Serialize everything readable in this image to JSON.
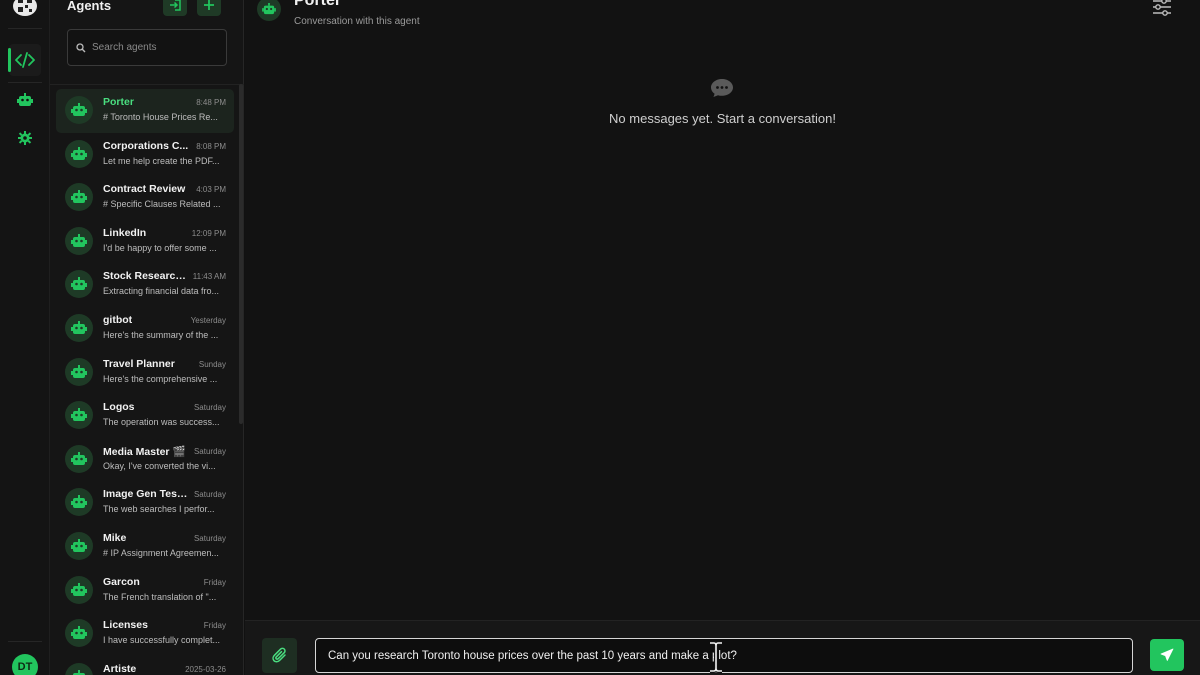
{
  "rail": {
    "user_initials": "DT"
  },
  "agents_panel": {
    "title": "Agents",
    "search_placeholder": "Search agents",
    "items": [
      {
        "name": "Porter",
        "time": "8:48 PM",
        "preview": "# Toronto House Prices Re..."
      },
      {
        "name": "Corporations C...",
        "time": "8:08 PM",
        "preview": "Let me help create the PDF..."
      },
      {
        "name": "Contract Review",
        "time": "4:03 PM",
        "preview": "# Specific Clauses Related ..."
      },
      {
        "name": "LinkedIn",
        "time": "12:09 PM",
        "preview": "I'd be happy to offer some ..."
      },
      {
        "name": "Stock Research...",
        "time": "11:43 AM",
        "preview": "Extracting financial data fro..."
      },
      {
        "name": "gitbot",
        "time": "Yesterday",
        "preview": "Here's the summary of the ..."
      },
      {
        "name": "Travel Planner",
        "time": "Sunday",
        "preview": "Here's the comprehensive ..."
      },
      {
        "name": "Logos",
        "time": "Saturday",
        "preview": "The operation was success..."
      },
      {
        "name": "Media Master 🎬",
        "time": "Saturday",
        "preview": "Okay, I've converted the vi..."
      },
      {
        "name": "Image Gen Test...",
        "time": "Saturday",
        "preview": "The web searches I perfor..."
      },
      {
        "name": "Mike",
        "time": "Saturday",
        "preview": "# IP Assignment Agreemen..."
      },
      {
        "name": "Garcon",
        "time": "Friday",
        "preview": "The French translation of \"..."
      },
      {
        "name": "Licenses",
        "time": "Friday",
        "preview": "I have successfully complet..."
      },
      {
        "name": "Artiste",
        "time": "2025-03-26",
        "preview": ""
      }
    ]
  },
  "chat": {
    "title": "Porter",
    "subtitle": "Conversation with this agent",
    "empty_message": "No messages yet. Start a conversation!",
    "input_value": "Can you research Toronto house prices over the past 10 years and make a plot?"
  },
  "colors": {
    "accent": "#22c55e",
    "background": "#121212",
    "sidebar": "#151515"
  },
  "icons": [
    "qr-logo-icon",
    "code-icon",
    "robot-icon",
    "gear-icon",
    "login-icon",
    "plus-icon",
    "search-icon",
    "sliders-icon",
    "chat-bubble-icon",
    "paperclip-icon",
    "send-icon",
    "text-cursor-icon"
  ]
}
